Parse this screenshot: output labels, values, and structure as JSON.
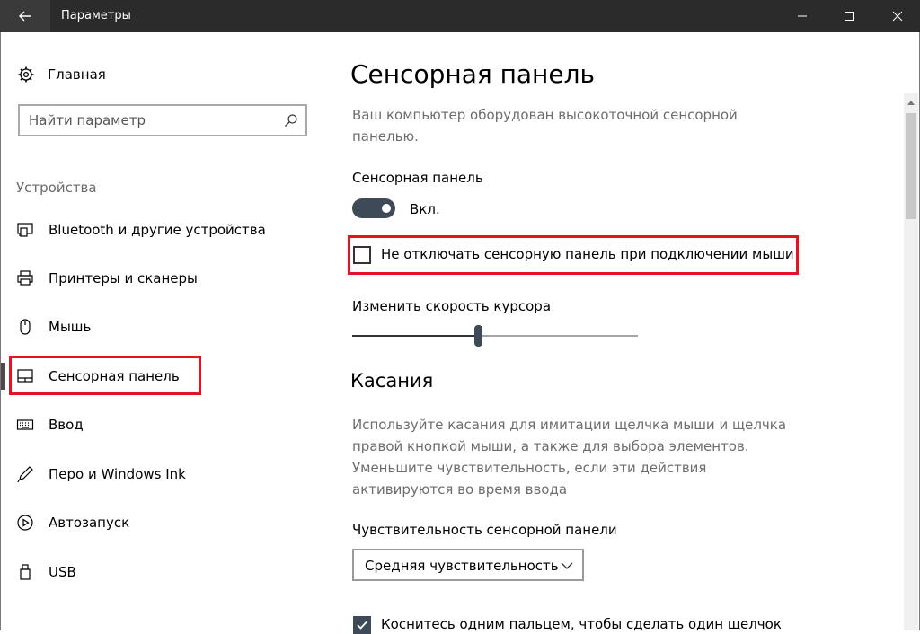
{
  "window": {
    "title": "Параметры"
  },
  "sidebar": {
    "home_label": "Главная",
    "search_placeholder": "Найти параметр",
    "section_header": "Устройства",
    "items": [
      {
        "label": "Bluetooth и другие устройства",
        "icon": "bluetooth-devices-icon"
      },
      {
        "label": "Принтеры и сканеры",
        "icon": "printer-icon"
      },
      {
        "label": "Мышь",
        "icon": "mouse-icon"
      },
      {
        "label": "Сенсорная панель",
        "icon": "touchpad-icon",
        "selected": true
      },
      {
        "label": "Ввод",
        "icon": "keyboard-icon"
      },
      {
        "label": "Перо и Windows Ink",
        "icon": "pen-icon"
      },
      {
        "label": "Автозапуск",
        "icon": "autoplay-icon"
      },
      {
        "label": "USB",
        "icon": "usb-icon"
      }
    ]
  },
  "main": {
    "title": "Сенсорная панель",
    "description": "Ваш компьютер оборудован высокоточной сенсорной панелью.",
    "touchpad_label": "Сенсорная панель",
    "toggle_state": "Вкл.",
    "toggle_on": true,
    "keep_on_checkbox_label": "Не отключать сенсорную панель при подключении мыши",
    "keep_on_checked": false,
    "cursor_speed_label": "Изменить скорость курсора",
    "cursor_speed_value": 0.44,
    "taps_header": "Касания",
    "taps_description": "Используйте касания для имитации щелчка мыши и щелчка правой кнопкой мыши, а также для выбора элементов. Уменьшите чувствительность, если эти действия активируются во время ввода",
    "sensitivity_label": "Чувствительность сенсорной панели",
    "sensitivity_value": "Средняя чувствительность",
    "single_tap_checkbox_label": "Коснитесь одним пальцем, чтобы сделать один щелчок",
    "single_tap_checked": true
  },
  "colors": {
    "titlebar": "#2b2b2b",
    "accent": "#3f4a58",
    "highlight": "#e81123"
  }
}
